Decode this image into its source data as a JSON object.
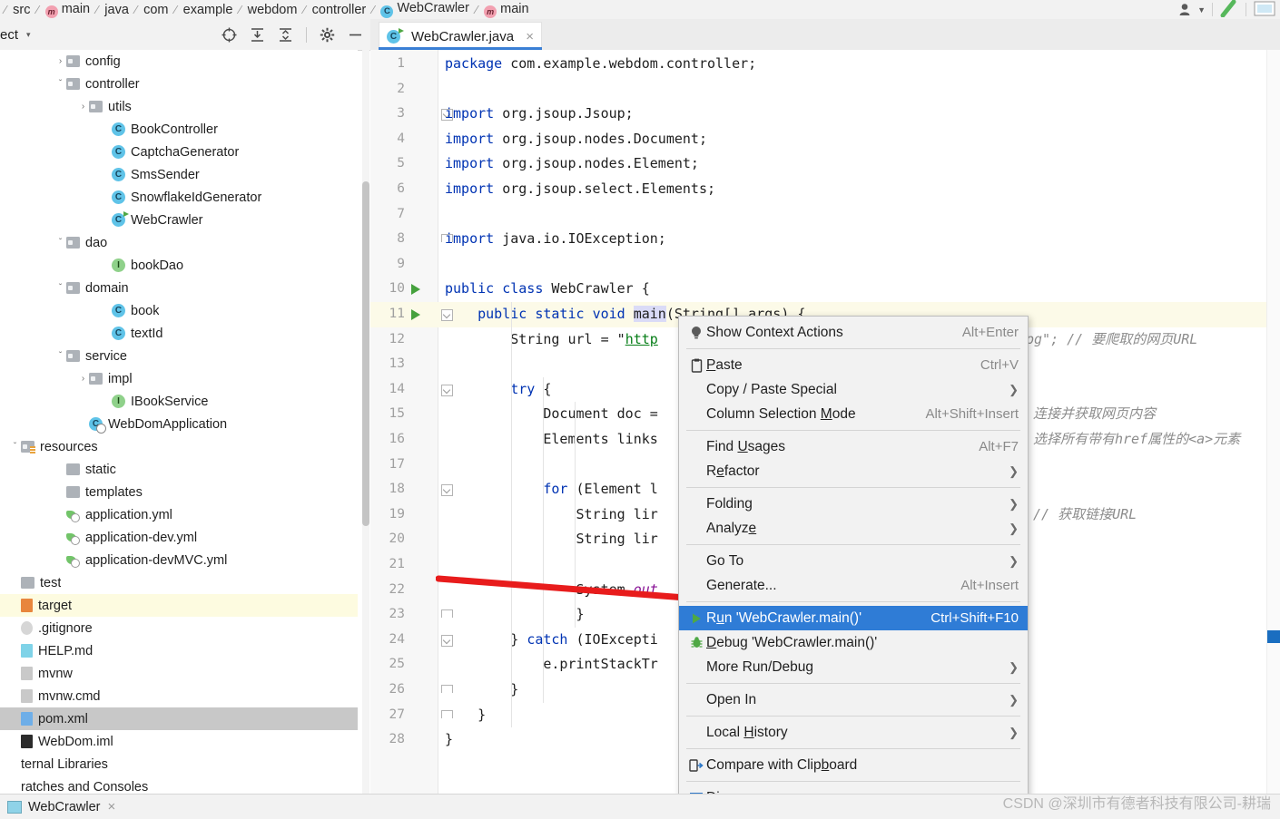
{
  "breadcrumb": {
    "items": [
      "src",
      "main",
      "java",
      "com",
      "example",
      "webdom",
      "controller",
      "WebCrawler",
      "main"
    ],
    "class_icon": "class-icon",
    "method_icon": "method-icon"
  },
  "topright": {
    "profile_icon": "user-profile-icon",
    "caret_icon": "chevron-down-icon",
    "search_icon": "search-icon",
    "layout_icon": "layout-icon"
  },
  "project_toolbar": {
    "title": "ect",
    "caret": "▾",
    "icons": [
      "locate-icon",
      "expand-all-icon",
      "collapse-all-icon",
      "settings-gear-icon",
      "hide-icon"
    ]
  },
  "editor_tab": {
    "filename": "WebCrawler.java",
    "close": "×",
    "icon": "java-class-runnable-icon"
  },
  "sidebar": {
    "items": [
      {
        "indent": 2,
        "arrow": "›",
        "icon": "folder",
        "label": "config"
      },
      {
        "indent": 2,
        "arrow": "ˇ",
        "icon": "folder",
        "label": "controller"
      },
      {
        "indent": 3,
        "arrow": "›",
        "icon": "folder",
        "label": "utils"
      },
      {
        "indent": 4,
        "arrow": "",
        "icon": "class",
        "label": "BookController"
      },
      {
        "indent": 4,
        "arrow": "",
        "icon": "class",
        "label": "CaptchaGenerator"
      },
      {
        "indent": 4,
        "arrow": "",
        "icon": "class",
        "label": "SmsSender"
      },
      {
        "indent": 4,
        "arrow": "",
        "icon": "class",
        "label": "SnowflakeIdGenerator"
      },
      {
        "indent": 4,
        "arrow": "",
        "icon": "class-run",
        "label": "WebCrawler"
      },
      {
        "indent": 2,
        "arrow": "ˇ",
        "icon": "folder",
        "label": "dao"
      },
      {
        "indent": 4,
        "arrow": "",
        "icon": "interface",
        "label": "bookDao"
      },
      {
        "indent": 2,
        "arrow": "ˇ",
        "icon": "folder",
        "label": "domain"
      },
      {
        "indent": 4,
        "arrow": "",
        "icon": "class",
        "label": "book"
      },
      {
        "indent": 4,
        "arrow": "",
        "icon": "class",
        "label": "textId"
      },
      {
        "indent": 2,
        "arrow": "ˇ",
        "icon": "folder",
        "label": "service"
      },
      {
        "indent": 3,
        "arrow": "›",
        "icon": "folder",
        "label": "impl"
      },
      {
        "indent": 4,
        "arrow": "",
        "icon": "interface",
        "label": "IBookService"
      },
      {
        "indent": 3,
        "arrow": "",
        "icon": "class-spring",
        "label": "WebDomApplication"
      },
      {
        "indent": 0,
        "arrow": "ˇ",
        "icon": "folder-res",
        "label": "resources"
      },
      {
        "indent": 2,
        "arrow": "",
        "icon": "folder-plain",
        "label": "static"
      },
      {
        "indent": 2,
        "arrow": "",
        "icon": "folder-plain",
        "label": "templates"
      },
      {
        "indent": 2,
        "arrow": "",
        "icon": "yml",
        "label": "application.yml"
      },
      {
        "indent": 2,
        "arrow": "",
        "icon": "yml",
        "label": "application-dev.yml"
      },
      {
        "indent": 2,
        "arrow": "",
        "icon": "yml",
        "label": "application-devMVC.yml"
      },
      {
        "indent": 0,
        "arrow": "",
        "icon": "folder-plain",
        "label": "test"
      },
      {
        "indent": 0,
        "arrow": "",
        "icon": "file-orange",
        "label": "target",
        "state": "highlighted"
      },
      {
        "indent": 0,
        "arrow": "",
        "icon": "file-git",
        "label": ".gitignore"
      },
      {
        "indent": 0,
        "arrow": "",
        "icon": "file-blue",
        "label": "HELP.md"
      },
      {
        "indent": 0,
        "arrow": "",
        "icon": "file-plain",
        "label": "mvnw"
      },
      {
        "indent": 0,
        "arrow": "",
        "icon": "file-plain",
        "label": "mvnw.cmd"
      },
      {
        "indent": 0,
        "arrow": "",
        "icon": "file-xml",
        "label": "pom.xml",
        "state": "selected"
      },
      {
        "indent": 0,
        "arrow": "",
        "icon": "file-dark",
        "label": "WebDom.iml"
      },
      {
        "indent": 0,
        "arrow": "",
        "icon": "none",
        "label": "ternal Libraries"
      },
      {
        "indent": 0,
        "arrow": "",
        "icon": "none",
        "label": "ratches and Consoles"
      }
    ]
  },
  "editor": {
    "lines": [
      {
        "n": 1,
        "text": "package com.example.webdom.controller;"
      },
      {
        "n": 2,
        "text": ""
      },
      {
        "n": 3,
        "text": "import org.jsoup.Jsoup;"
      },
      {
        "n": 4,
        "text": "import org.jsoup.nodes.Document;"
      },
      {
        "n": 5,
        "text": "import org.jsoup.nodes.Element;"
      },
      {
        "n": 6,
        "text": "import org.jsoup.select.Elements;"
      },
      {
        "n": 7,
        "text": ""
      },
      {
        "n": 8,
        "text": "import java.io.IOException;"
      },
      {
        "n": 9,
        "text": ""
      },
      {
        "n": 10,
        "text": "public class WebCrawler {"
      },
      {
        "n": 11,
        "text": "    public static void main(String[] args) {"
      },
      {
        "n": 12,
        "text": "        String url = \"http"
      },
      {
        "n": 13,
        "text": ""
      },
      {
        "n": 14,
        "text": "        try {"
      },
      {
        "n": 15,
        "text": "            Document doc ="
      },
      {
        "n": 16,
        "text": "            Elements links"
      },
      {
        "n": 17,
        "text": ""
      },
      {
        "n": 18,
        "text": "            for (Element l"
      },
      {
        "n": 19,
        "text": "                String lir"
      },
      {
        "n": 20,
        "text": "                String lir"
      },
      {
        "n": 21,
        "text": ""
      },
      {
        "n": 22,
        "text": "                System.out"
      },
      {
        "n": 23,
        "text": "                }"
      },
      {
        "n": 24,
        "text": "        } catch (IOExcepti"
      },
      {
        "n": 25,
        "text": "            e.printStackTr"
      },
      {
        "n": 26,
        "text": "        }"
      },
      {
        "n": 27,
        "text": "    }"
      },
      {
        "n": 28,
        "text": "}"
      }
    ],
    "comments": {
      "line12_tail": "pg\"; // 要爬取的网页URL",
      "line15": "连接并获取网页内容",
      "line16": "选择所有带有href属性的<a>元素",
      "line19": "// 获取链接URL"
    }
  },
  "context_menu": {
    "items": [
      {
        "label": "Show Context Actions",
        "shortcut": "Alt+Enter",
        "icon": "lightbulb-icon",
        "submenu": false
      },
      {
        "sep": true
      },
      {
        "label": "Paste",
        "shortcut": "Ctrl+V",
        "icon": "clipboard-icon",
        "submenu": false,
        "mnemonic": "P"
      },
      {
        "label": "Copy / Paste Special",
        "shortcut": "",
        "icon": "",
        "submenu": true
      },
      {
        "label": "Column Selection Mode",
        "shortcut": "Alt+Shift+Insert",
        "icon": "",
        "submenu": false,
        "mnemonic": "M"
      },
      {
        "sep": true
      },
      {
        "label": "Find Usages",
        "shortcut": "Alt+F7",
        "icon": "",
        "submenu": false,
        "mnemonic": "U"
      },
      {
        "label": "Refactor",
        "shortcut": "",
        "icon": "",
        "submenu": true,
        "mnemonic": "R"
      },
      {
        "sep": true
      },
      {
        "label": "Folding",
        "shortcut": "",
        "icon": "",
        "submenu": true
      },
      {
        "label": "Analyze",
        "shortcut": "",
        "icon": "",
        "submenu": true,
        "mnemonic": "z"
      },
      {
        "sep": true
      },
      {
        "label": "Go To",
        "shortcut": "",
        "icon": "",
        "submenu": true
      },
      {
        "label": "Generate...",
        "shortcut": "Alt+Insert",
        "icon": "",
        "submenu": false
      },
      {
        "sep": true
      },
      {
        "label": "Run 'WebCrawler.main()'",
        "shortcut": "Ctrl+Shift+F10",
        "icon": "run-triangle-icon",
        "submenu": false,
        "highlighted": true
      },
      {
        "label": "Debug 'WebCrawler.main()'",
        "shortcut": "",
        "icon": "debug-bug-icon",
        "submenu": false
      },
      {
        "label": "More Run/Debug",
        "shortcut": "",
        "icon": "",
        "submenu": true
      },
      {
        "sep": true
      },
      {
        "label": "Open In",
        "shortcut": "",
        "icon": "",
        "submenu": true
      },
      {
        "sep": true
      },
      {
        "label": "Local History",
        "shortcut": "",
        "icon": "",
        "submenu": true
      },
      {
        "sep": true
      },
      {
        "label": "Compare with Clipboard",
        "shortcut": "",
        "icon": "compare-clipboard-icon",
        "submenu": false
      },
      {
        "sep": true
      },
      {
        "label": "Diagrams",
        "shortcut": "",
        "icon": "diagrams-icon",
        "submenu": false
      }
    ]
  },
  "bottom_bar": {
    "run_tab_label": "WebCrawler",
    "run_tab_close": "×"
  },
  "watermark": {
    "text": "CSDN @深圳市有德者科技有限公司-耕瑞"
  },
  "colors": {
    "accent_blue": "#2f7cd6",
    "tab_underline": "#3a7fd5",
    "run_green": "#45a13d",
    "arrow_red": "#e81c1c",
    "keyword": "#0033b3",
    "string": "#067d17",
    "comment": "#8c8c8c",
    "selection": "#dadbf7",
    "line_highlight": "#fcfae8",
    "tree_selected": "#c8c8c8",
    "tree_highlight": "#fdfbe0"
  }
}
